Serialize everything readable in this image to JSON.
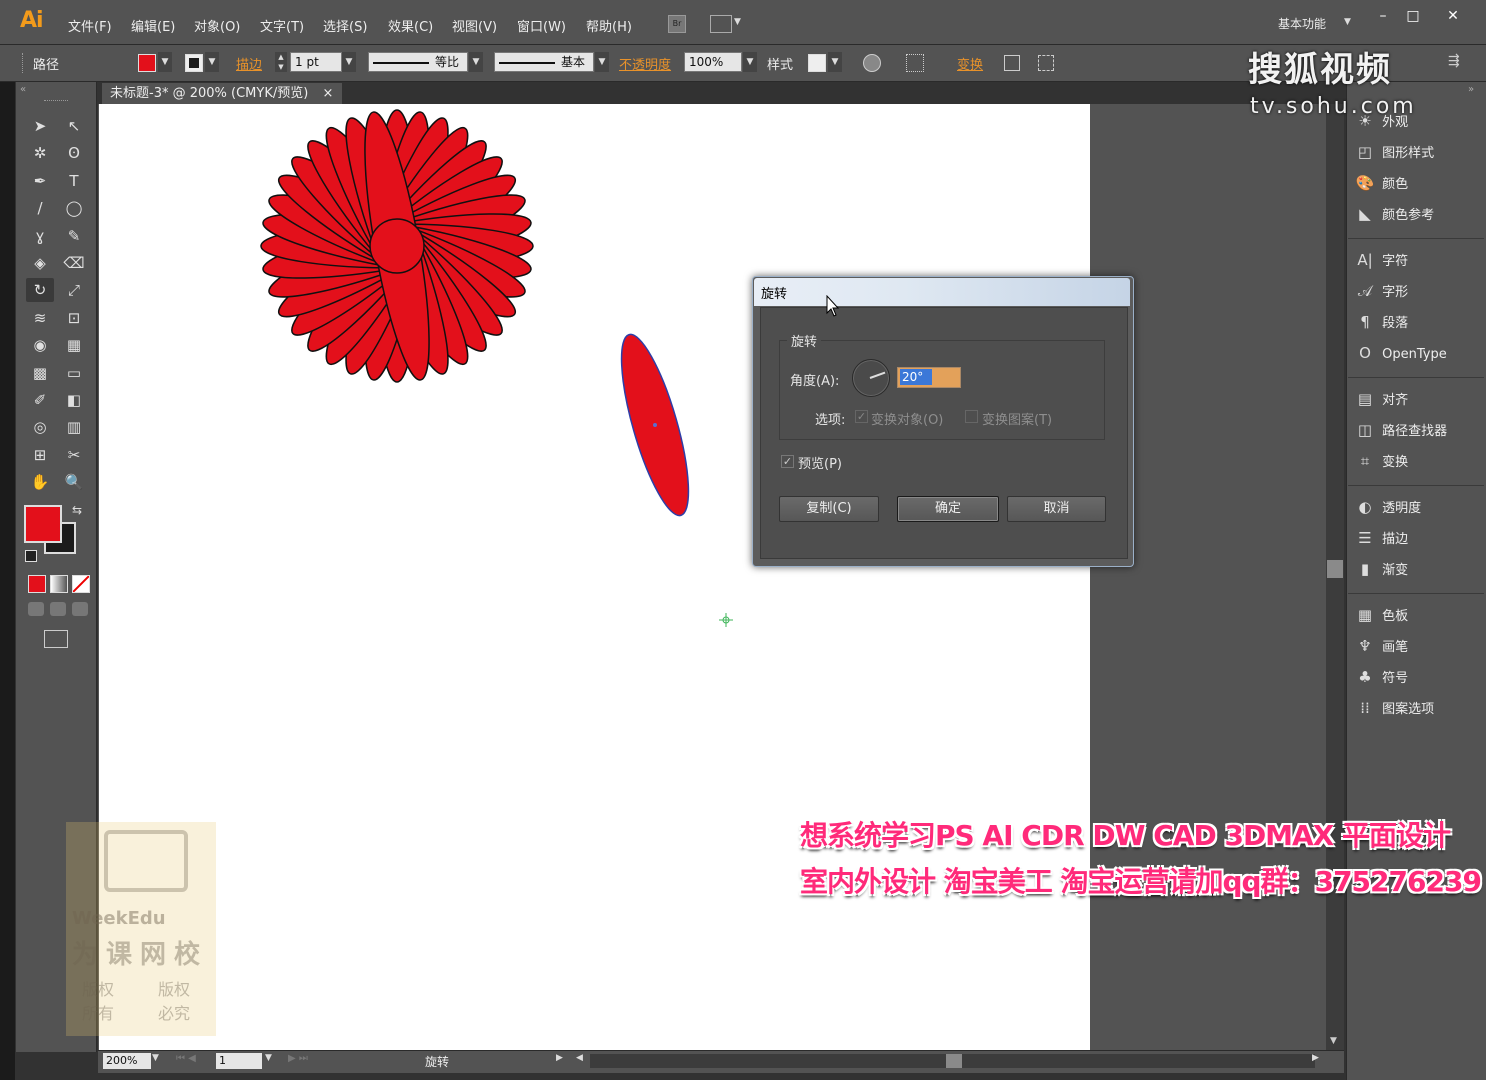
{
  "app": {
    "logo": "Ai",
    "workspace": "基本功能"
  },
  "menu": [
    "文件(F)",
    "编辑(E)",
    "对象(O)",
    "文字(T)",
    "选择(S)",
    "效果(C)",
    "视图(V)",
    "窗口(W)",
    "帮助(H)"
  ],
  "bridge_label": "Br",
  "window_buttons": {
    "minimize": "–",
    "maximize": "□",
    "close": "✕"
  },
  "control": {
    "object_type": "路径",
    "stroke_label": "描边",
    "stroke_weight": "1 pt",
    "profile_label": "等比",
    "brush_label": "基本",
    "opacity_label": "不透明度",
    "opacity_value": "100%",
    "style_label": "样式",
    "transform_label": "变换"
  },
  "document": {
    "tab_title": "未标题-3* @ 200% (CMYK/预览)",
    "close": "×"
  },
  "colors": {
    "fill": "#e3101b",
    "stroke": "#000000",
    "accent": "#e8922a",
    "selection": "#3b78d8"
  },
  "tools": [
    "selection-tool",
    "direct-selection-tool",
    "magic-wand-tool",
    "lasso-tool",
    "pen-tool",
    "type-tool",
    "line-tool",
    "ellipse-tool",
    "paintbrush-tool",
    "pencil-tool",
    "blob-brush-tool",
    "eraser-tool",
    "rotate-tool",
    "scale-tool",
    "width-tool",
    "free-transform-tool",
    "shape-builder-tool",
    "perspective-grid-tool",
    "mesh-tool",
    "gradient-tool",
    "eyedropper-tool",
    "blend-tool",
    "symbol-sprayer-tool",
    "column-graph-tool",
    "artboard-tool",
    "slice-tool",
    "hand-tool",
    "zoom-tool"
  ],
  "tool_glyphs": [
    "➤",
    "↖",
    "✲",
    "ʘ",
    "✒",
    "T",
    "/",
    "◯",
    "ɣ",
    "✎",
    "◈",
    "⌫",
    "↻",
    "⤢",
    "≋",
    "⊡",
    "◉",
    "▦",
    "▩",
    "▭",
    "✐",
    "◧",
    "◎",
    "▥",
    "⊞",
    "✂",
    "✋",
    "🔍"
  ],
  "right_panels": [
    {
      "group": 1,
      "items": [
        {
          "icon": "☀",
          "label": "外观"
        },
        {
          "icon": "◰",
          "label": "图形样式"
        },
        {
          "icon": "🎨",
          "label": "颜色"
        },
        {
          "icon": "◣",
          "label": "颜色参考"
        }
      ]
    },
    {
      "group": 2,
      "items": [
        {
          "icon": "A|",
          "label": "字符"
        },
        {
          "icon": "𝒜",
          "label": "字形"
        },
        {
          "icon": "¶",
          "label": "段落"
        },
        {
          "icon": "O",
          "label": "OpenType"
        }
      ]
    },
    {
      "group": 3,
      "items": [
        {
          "icon": "▤",
          "label": "对齐"
        },
        {
          "icon": "◫",
          "label": "路径查找器"
        },
        {
          "icon": "⌗",
          "label": "变换"
        }
      ]
    },
    {
      "group": 4,
      "items": [
        {
          "icon": "◐",
          "label": "透明度"
        },
        {
          "icon": "☰",
          "label": "描边"
        },
        {
          "icon": "▮",
          "label": "渐变"
        }
      ]
    },
    {
      "group": 5,
      "items": [
        {
          "icon": "▦",
          "label": "色板"
        },
        {
          "icon": "♆",
          "label": "画笔"
        },
        {
          "icon": "♣",
          "label": "符号"
        },
        {
          "icon": "⁞⁞",
          "label": "图案选项"
        }
      ]
    }
  ],
  "dialog": {
    "title": "旋转",
    "section": "旋转",
    "angle_label": "角度(A):",
    "angle_value": "20°",
    "options_label": "选项:",
    "transform_objects": "变换对象(O)",
    "transform_patterns": "变换图案(T)",
    "preview": "预览(P)",
    "copy_btn": "复制(C)",
    "ok_btn": "确定",
    "cancel_btn": "取消"
  },
  "status": {
    "zoom": "200%",
    "page": "1",
    "tool_name": "旋转"
  },
  "overlay": {
    "sohu_logo": "搜狐视频",
    "sohu_url": "tv.sohu.com",
    "promo_line1": "想系统学习PS AI CDR DW CAD 3DMAX 平面设计",
    "promo_line2": "室内外设计 淘宝美工 淘宝运营请加qq群：375276239",
    "watermark_brand": "WeekEdu",
    "watermark_name": "为课网校",
    "watermark_rights1": "版权所有",
    "watermark_rights2": "版权必究"
  }
}
